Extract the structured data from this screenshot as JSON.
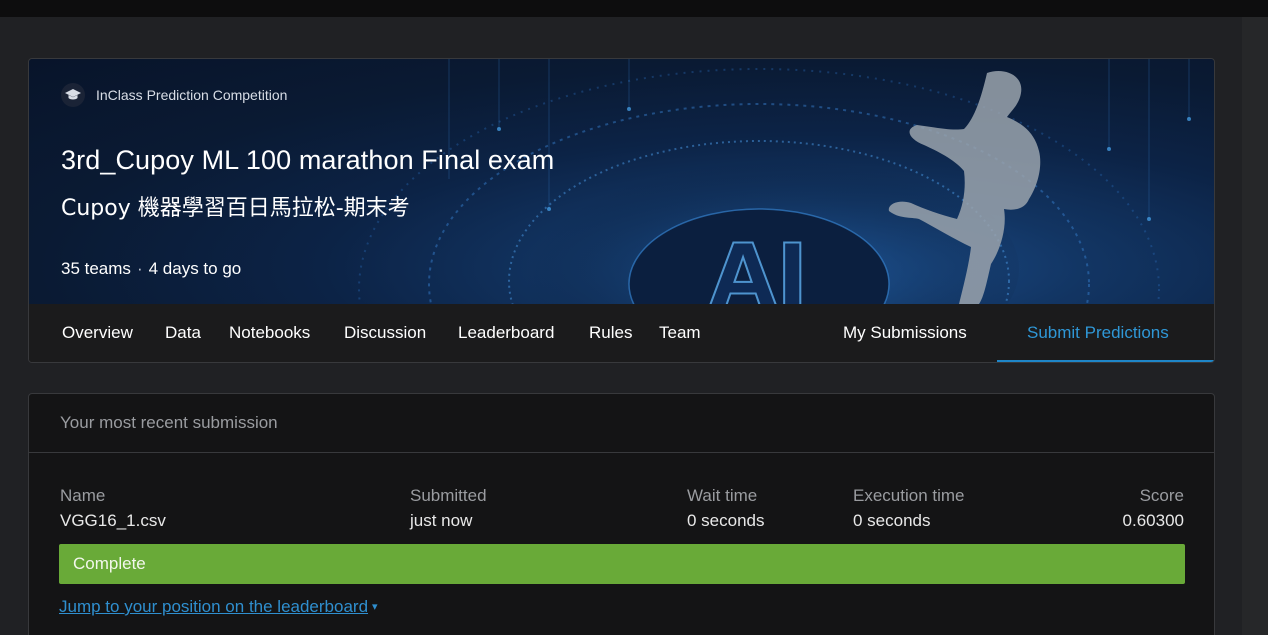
{
  "header": {
    "competition_type": "InClass Prediction Competition",
    "title": "3rd_Cupoy ML 100 marathon Final exam",
    "subtitle": "Cupoy 機器學習百日馬拉松-期末考",
    "teams": "35 teams",
    "separator": "·",
    "deadline": "4 days to go",
    "banner_text": "AI"
  },
  "nav": {
    "items": [
      "Overview",
      "Data",
      "Notebooks",
      "Discussion",
      "Leaderboard",
      "Rules",
      "Team"
    ],
    "my_submissions": "My Submissions",
    "submit_predictions": "Submit Predictions"
  },
  "submission": {
    "heading": "Your most recent submission",
    "columns": {
      "name": {
        "label": "Name",
        "value": "VGG16_1.csv"
      },
      "submitted": {
        "label": "Submitted",
        "value": "just now"
      },
      "wait_time": {
        "label": "Wait time",
        "value": "0 seconds"
      },
      "execution_time": {
        "label": "Execution time",
        "value": "0 seconds"
      },
      "score": {
        "label": "Score",
        "value": "0.60300"
      }
    },
    "status": "Complete",
    "jump_link": "Jump to your position on the leaderboard",
    "jump_caret": "▾"
  },
  "colors": {
    "background": "#202124",
    "accent": "#2f97d6",
    "status_complete": "#69aa38",
    "banner": "#0c2346"
  },
  "icons": {
    "competition_type": "graduation-cap-icon",
    "jump_caret": "chevron-down-icon"
  }
}
